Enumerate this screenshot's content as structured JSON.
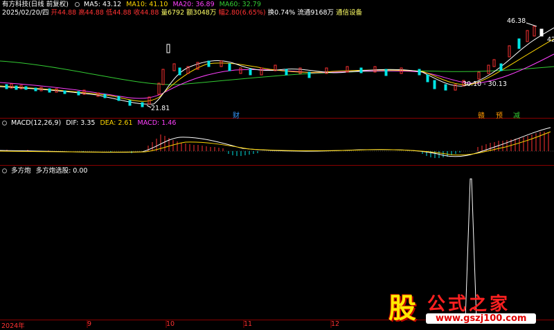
{
  "header": {
    "stock_title": "有方科技(日线 前复权)",
    "ma_labels": [
      {
        "text": "MA5: 43.12",
        "color": "#ffffff"
      },
      {
        "text": "MA10: 41.10",
        "color": "#ffd700"
      },
      {
        "text": "MA20: 36.89",
        "color": "#ff40ff"
      },
      {
        "text": "MA60: 32.79",
        "color": "#33cc33"
      }
    ],
    "date": "2025/02/20/四",
    "open": "开44.88",
    "high": "高44.88",
    "low": "低44.88",
    "close": "收44.88",
    "volume": "量6792",
    "amount": "额3048万",
    "change": "幅2.80(6.65%)",
    "turnover": "换0.74%",
    "float": "流通9168万",
    "sector": "通信设备"
  },
  "price_panel": {
    "high_label": "46.38",
    "low_label": "21.81",
    "range_label": "30.10 - 30.13",
    "right_edge_label": "42",
    "event_markers": [
      {
        "text": "财",
        "color": "#3399ff"
      },
      {
        "text": "赣",
        "color": "#ff9900"
      },
      {
        "text": "预",
        "color": "#ff9900"
      },
      {
        "text": "减",
        "color": "#33cc33"
      }
    ]
  },
  "macd_panel": {
    "title": "MACD(12,26,9)",
    "dif": "DIF: 3.35",
    "dea": "DEA: 2.61",
    "macd": "MACD: 1.46"
  },
  "indicator_panel": {
    "name": "多方炮",
    "value_label": "多方炮选股: 0.00"
  },
  "x_axis": {
    "labels": [
      "2024年",
      "9",
      "10",
      "11",
      "12"
    ]
  },
  "watermark": {
    "glyph": "股",
    "title": "公式之家",
    "url": "www.gszj100.com"
  },
  "colors": {
    "up": "#ff3232",
    "down": "#00e5e5",
    "ma5": "#ffffff",
    "ma10": "#ffd700",
    "ma20": "#ff40ff",
    "ma60": "#33cc33",
    "divider": "#8b0000"
  }
}
